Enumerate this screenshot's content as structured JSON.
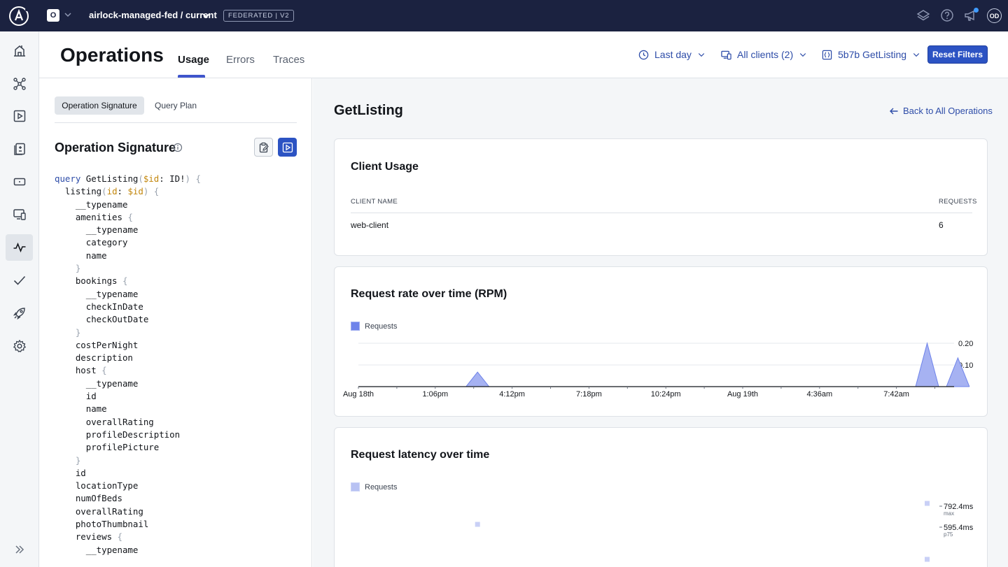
{
  "topbar": {
    "org_initial": "O",
    "graph_name": "airlock-managed-fed / current",
    "federated_badge": "FEDERATED | V2",
    "avatar_initials": "OD"
  },
  "header": {
    "title": "Operations",
    "tabs": [
      {
        "label": "Usage",
        "active": true
      },
      {
        "label": "Errors",
        "active": false
      },
      {
        "label": "Traces",
        "active": false
      }
    ],
    "filters": {
      "time": "Last day",
      "clients": "All clients (2)",
      "operation": "5b7b GetListing"
    },
    "reset_label": "Reset Filters"
  },
  "left": {
    "segments": {
      "active": "Operation Signature",
      "inactive": "Query Plan"
    },
    "signature_title": "Operation Signature"
  },
  "right": {
    "operation_title": "GetListing",
    "back_label": "Back to All Operations",
    "client_usage": {
      "title": "Client Usage",
      "columns": [
        "CLIENT NAME",
        "REQUESTS"
      ],
      "rows": [
        {
          "client": "web-client",
          "requests": "6"
        }
      ]
    },
    "rpm_title": "Request rate over time (RPM)",
    "latency_title": "Request latency over time",
    "legend_label": "Requests"
  },
  "colors": {
    "accent": "#2c53c3",
    "topbar": "#1b2240",
    "series": "#6e83ea"
  },
  "chart_data": [
    {
      "type": "area",
      "title": "Request rate over time (RPM)",
      "legend": [
        "Requests"
      ],
      "x_ticks": [
        "Aug 18th",
        "1:06pm",
        "4:12pm",
        "7:18pm",
        "10:24pm",
        "Aug 19th",
        "4:36am",
        "7:42am"
      ],
      "y_ticks": [
        "0.10",
        "0.20"
      ],
      "ylim": [
        0,
        0.2
      ],
      "series": [
        {
          "name": "Requests",
          "points": [
            {
              "t": 0.0,
              "v": 0
            },
            {
              "t": 1.4,
              "v": 0
            },
            {
              "t": 1.55,
              "v": 0.067
            },
            {
              "t": 1.7,
              "v": 0
            },
            {
              "t": 7.25,
              "v": 0
            },
            {
              "t": 7.4,
              "v": 0.2
            },
            {
              "t": 7.55,
              "v": 0
            },
            {
              "t": 7.65,
              "v": 0
            },
            {
              "t": 7.8,
              "v": 0.133
            },
            {
              "t": 7.95,
              "v": 0
            },
            {
              "t": 7.95,
              "v": 0
            }
          ]
        }
      ]
    },
    {
      "type": "scatter",
      "title": "Request latency over time",
      "legend": [
        "Requests"
      ],
      "y_ticks": [
        {
          "value": "792.4ms",
          "sub": "max"
        },
        {
          "value": "595.4ms",
          "sub": "p75"
        }
      ],
      "series": [
        {
          "name": "Requests",
          "points": [
            {
              "t": 1.55,
              "band": "p75"
            },
            {
              "t": 7.4,
              "band": "max"
            },
            {
              "t": 7.4,
              "band": "low"
            }
          ]
        }
      ]
    }
  ]
}
